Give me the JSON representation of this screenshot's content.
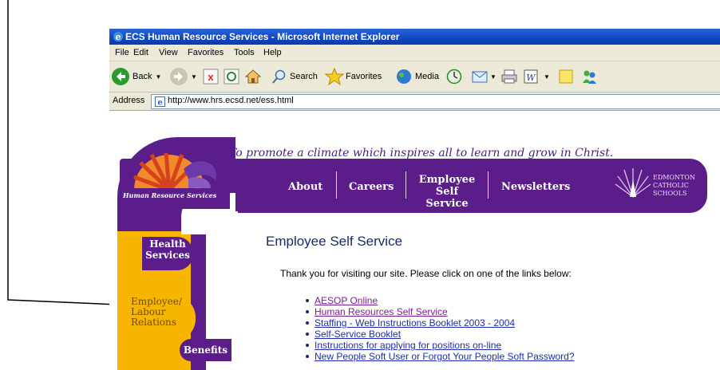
{
  "window": {
    "title": "ECS Human Resource Services - Microsoft Internet Explorer"
  },
  "menu": [
    "File",
    "Edit",
    "View",
    "Favorites",
    "Tools",
    "Help"
  ],
  "toolbar": {
    "back_label": "Back",
    "search_label": "Search",
    "favorites_label": "Favorites",
    "media_label": "Media"
  },
  "address": {
    "label": "Address",
    "url": "http://www.hrs.ecsd.net/ess.html"
  },
  "site": {
    "tagline": "To promote a climate which inspires all to learn and grow in Christ.",
    "logo_text": "Human Resource Services",
    "nav": {
      "about": "About",
      "careers": "Careers",
      "employee_line1": "Employee",
      "employee_line2": "Self Service",
      "newsletters": "Newsletters"
    },
    "school_logo": [
      "EDMONTON",
      "CATHOLIC",
      "SCHOOLS"
    ],
    "side_nav": {
      "health_line1": "Health",
      "health_line2": "Services",
      "employee_line1": "Employee/",
      "employee_line2": "Labour",
      "employee_line3": "Relations",
      "benefits": "Benefits"
    }
  },
  "page": {
    "heading": "Employee Self Service",
    "intro": "Thank you for visiting our site.  Please click on one of the links below:",
    "links": [
      "AESOP Online",
      "Human Resources Self Service",
      "Staffing -  Web Instructions Booklet 2003 - 2004",
      "Self-Service Booklet",
      "Instructions for applying for positions on-line",
      "New People Soft User or Forgot Your People Soft Password?"
    ]
  },
  "colors": {
    "purple": "#5b1d8a",
    "gold": "#f7b500",
    "link": "#1f2cb0",
    "visited_link": "#7a1f8f"
  }
}
